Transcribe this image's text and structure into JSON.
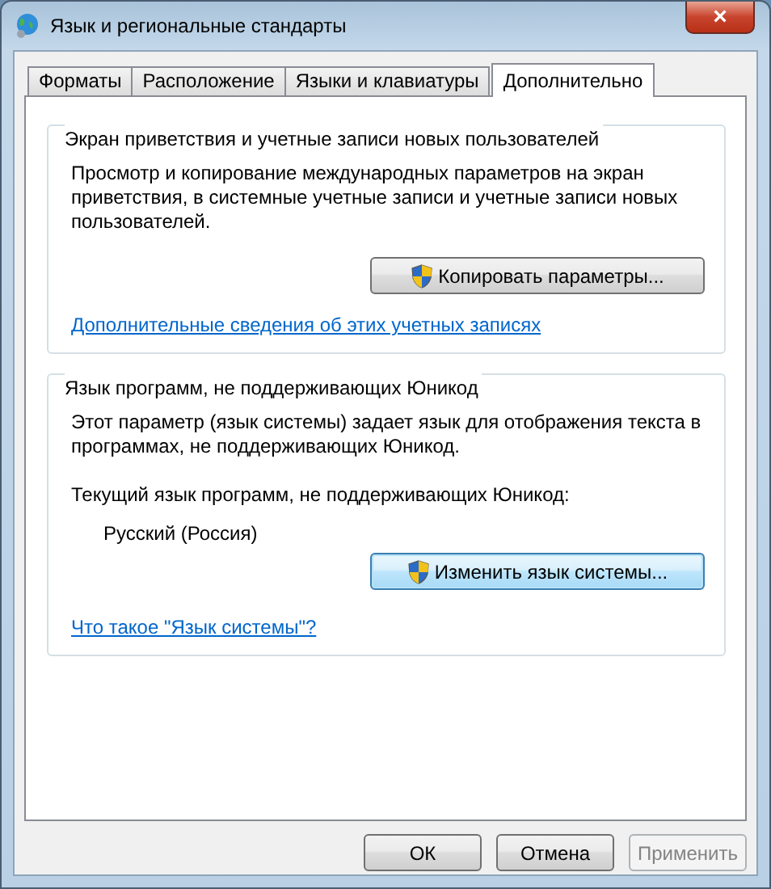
{
  "window": {
    "title": "Язык и региональные стандарты",
    "close": "×"
  },
  "tabs": [
    {
      "label": "Форматы",
      "selected": false
    },
    {
      "label": "Расположение",
      "selected": false
    },
    {
      "label": "Языки и клавиатуры",
      "selected": false
    },
    {
      "label": "Дополнительно",
      "selected": true
    }
  ],
  "groups": [
    {
      "title": "Экран приветствия и учетные записи новых пользователей",
      "description": "Просмотр и копирование международных параметров на экран приветствия, в системные учетные записи и учетные записи новых пользователей.",
      "button": {
        "label": "Копировать параметры...",
        "focused": false
      },
      "link": "Дополнительные сведения об этих учетных записях"
    },
    {
      "title": "Язык программ, не поддерживающих Юникод",
      "description": "Этот параметр (язык системы) задает язык для отображения текста в программах, не поддерживающих Юникод.",
      "current_label": "Текущий язык программ, не поддерживающих Юникод:",
      "current_value": "Русский (Россия)",
      "button": {
        "label": "Изменить язык системы...",
        "focused": true
      },
      "link": "Что такое \"Язык системы\"?"
    }
  ],
  "buttons": [
    {
      "label": "ОК",
      "disabled": false
    },
    {
      "label": "Отмена",
      "disabled": false
    },
    {
      "label": "Применить",
      "disabled": true
    }
  ]
}
